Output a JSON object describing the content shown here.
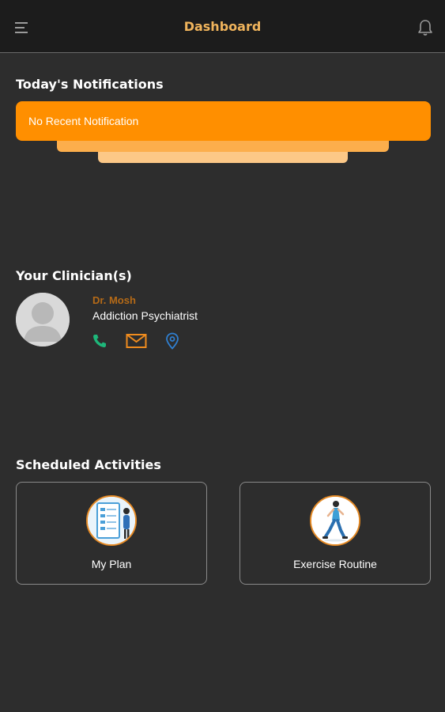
{
  "header": {
    "title": "Dashboard",
    "menu_icon": "menu-icon",
    "notification_icon": "bell-icon"
  },
  "notifications": {
    "heading": "Today's Notifications",
    "message": "No Recent Notification",
    "colors": {
      "card": "#ff8f00",
      "layer2": "#fcae4c",
      "layer3": "#fcc887"
    }
  },
  "clinicians": {
    "heading": "Your Clinician(s)",
    "items": [
      {
        "name": "Dr. Mosh",
        "role": "Addiction Psychiatrist",
        "actions": [
          "phone-icon",
          "mail-icon",
          "location-icon"
        ]
      }
    ]
  },
  "activities": {
    "heading": "Scheduled Activities",
    "items": [
      {
        "label": "My Plan",
        "icon": "plan-illustration-icon"
      },
      {
        "label": "Exercise Routine",
        "icon": "exercise-illustration-icon"
      }
    ]
  },
  "colors": {
    "background": "#2d2d2d",
    "topbar": "#1c1c1c",
    "accent": "#f0b45c",
    "doctor_name": "#b56a17",
    "phone": "#1eb77a",
    "mail": "#f08c1e",
    "location": "#2f7fd0"
  }
}
